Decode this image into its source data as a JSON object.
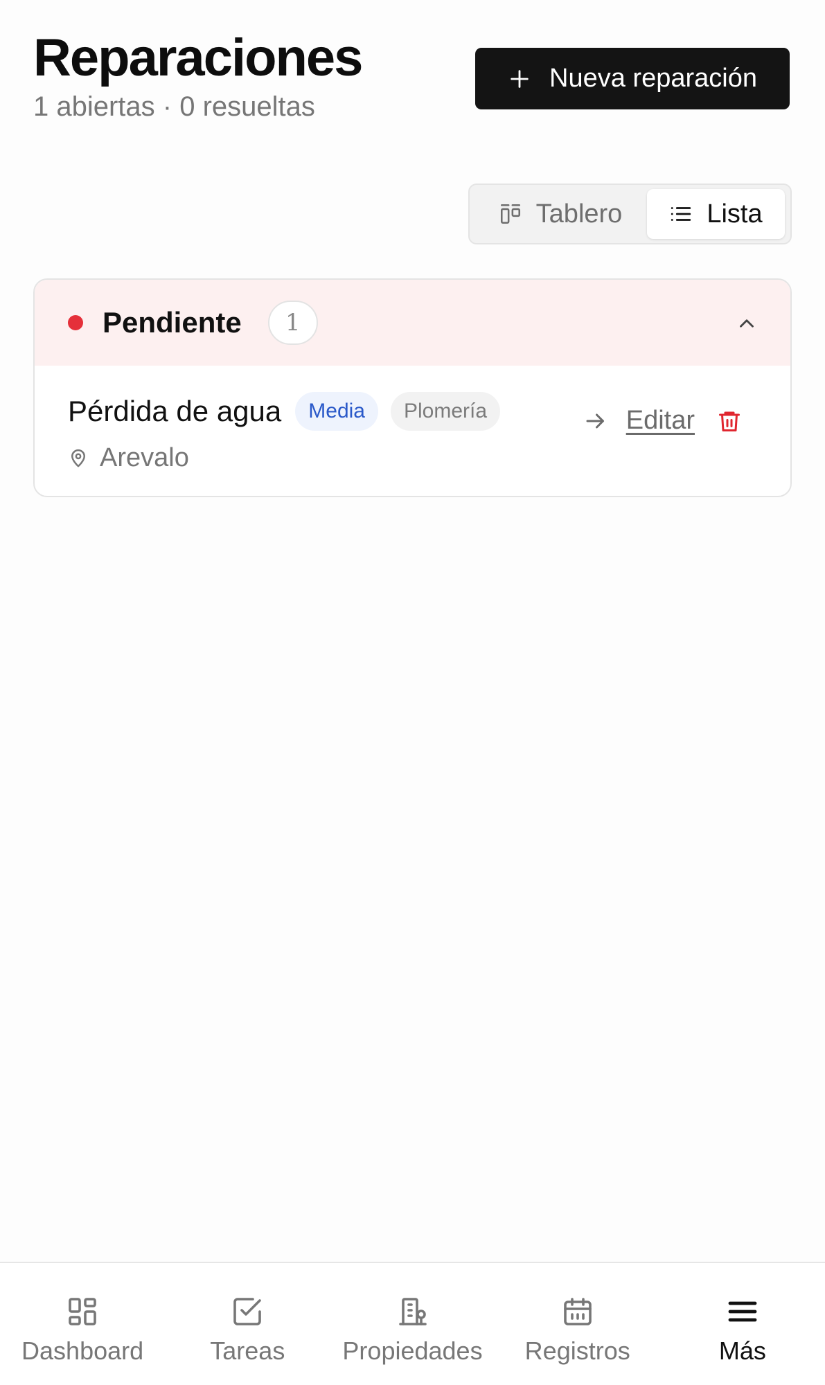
{
  "header": {
    "title": "Reparaciones",
    "subtitle": "1 abiertas · 0 resueltas",
    "new_button_label": "Nueva reparación"
  },
  "view_toggle": {
    "board_label": "Tablero",
    "list_label": "Lista",
    "selected": "Lista"
  },
  "groups": [
    {
      "name": "Pendiente",
      "count": "1",
      "status_color": "#e5303a",
      "items": [
        {
          "title": "Pérdida de agua",
          "priority": "Media",
          "category": "Plomería",
          "location": "Arevalo",
          "edit_label": "Editar"
        }
      ]
    }
  ],
  "bottom_nav": {
    "items": [
      {
        "label": "Dashboard",
        "icon": "dashboard-icon"
      },
      {
        "label": "Tareas",
        "icon": "checkbox-icon"
      },
      {
        "label": "Propiedades",
        "icon": "building-icon"
      },
      {
        "label": "Registros",
        "icon": "calendar-icon"
      },
      {
        "label": "Más",
        "icon": "menu-icon"
      }
    ],
    "active": "Más"
  },
  "colors": {
    "primary_button": "#141414",
    "pending_header_bg": "#fdf0f0",
    "priority_text": "#2a59c9",
    "delete_icon": "#e0262f"
  }
}
